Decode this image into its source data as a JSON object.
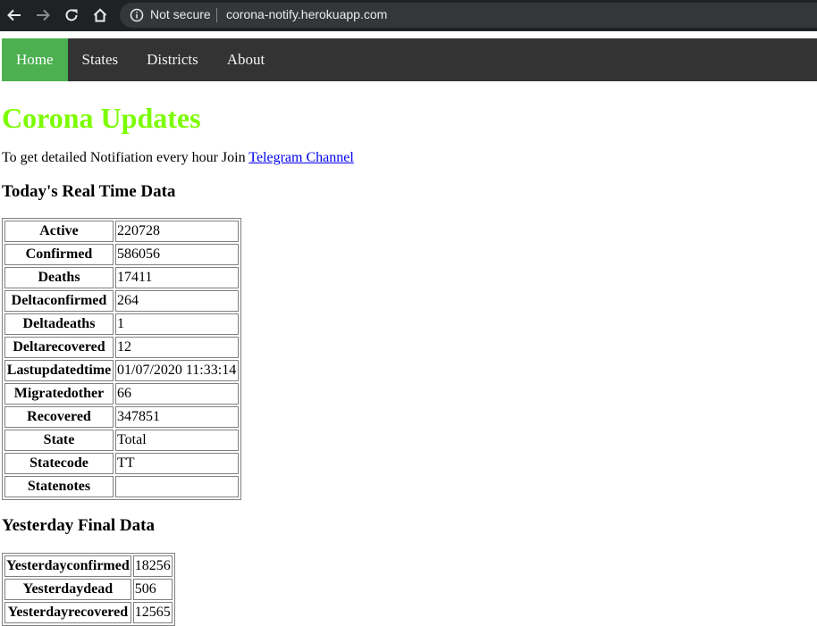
{
  "browser": {
    "security_label": "Not secure",
    "url": "corona-notify.herokuapp.com"
  },
  "nav": {
    "items": [
      "Home",
      "States",
      "Districts",
      "About"
    ]
  },
  "page": {
    "title": "Corona Updates",
    "intro_text": "To get detailed Notifiation every hour Join ",
    "intro_link": "Telegram Channel",
    "today_heading": "Today's Real Time Data",
    "yesterday_heading": "Yesterday Final Data"
  },
  "today": [
    {
      "label": "Active",
      "value": "220728"
    },
    {
      "label": "Confirmed",
      "value": "586056"
    },
    {
      "label": "Deaths",
      "value": "17411"
    },
    {
      "label": "Deltaconfirmed",
      "value": "264"
    },
    {
      "label": "Deltadeaths",
      "value": "1"
    },
    {
      "label": "Deltarecovered",
      "value": "12"
    },
    {
      "label": "Lastupdatedtime",
      "value": "01/07/2020 11:33:14"
    },
    {
      "label": "Migratedother",
      "value": "66"
    },
    {
      "label": "Recovered",
      "value": "347851"
    },
    {
      "label": "State",
      "value": "Total"
    },
    {
      "label": "Statecode",
      "value": "TT"
    },
    {
      "label": "Statenotes",
      "value": ""
    }
  ],
  "yesterday": [
    {
      "label": "Yesterdayconfirmed",
      "value": "18256"
    },
    {
      "label": "Yesterdaydead",
      "value": "506"
    },
    {
      "label": "Yesterdayrecovered",
      "value": "12565"
    }
  ],
  "colors": {
    "title": "#7cfc00",
    "nav_active": "#4caf50",
    "nav_bg": "#333333"
  }
}
